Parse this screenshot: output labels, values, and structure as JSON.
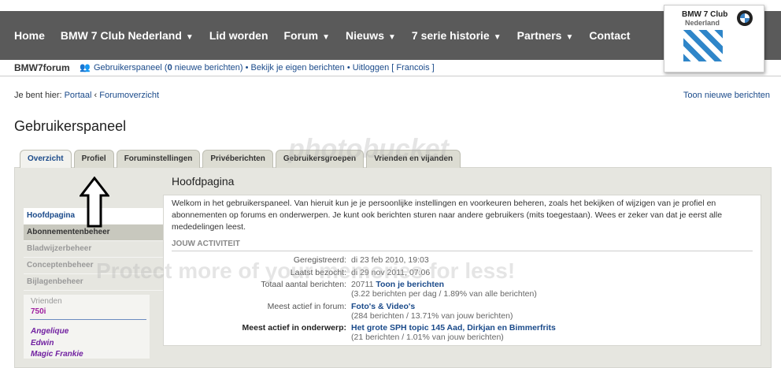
{
  "topnav": {
    "items": [
      {
        "label": "Home",
        "caret": false
      },
      {
        "label": "BMW 7 Club Nederland",
        "caret": true
      },
      {
        "label": "Lid worden",
        "caret": false
      },
      {
        "label": "Forum",
        "caret": true
      },
      {
        "label": "Nieuws",
        "caret": true
      },
      {
        "label": "7 serie historie",
        "caret": true
      },
      {
        "label": "Partners",
        "caret": true
      },
      {
        "label": "Contact",
        "caret": false
      }
    ]
  },
  "logo": {
    "line1": "BMW 7 Club",
    "line2": "Nederland"
  },
  "subbar": {
    "brand": "BMW7forum",
    "control_panel": "Gebruikerspaneel (",
    "new_count": "0",
    "new_messages": " nieuwe berichten)",
    "sep1": " • ",
    "own_posts": "Bekijk je eigen berichten",
    "sep2": " • ",
    "logout": "Uitloggen [ Francois ]"
  },
  "breadcrumb": {
    "prefix": "Je bent hier: ",
    "portal": "Portaal",
    "sep": " ‹ ",
    "forum": "Forumoverzicht"
  },
  "new_posts_link": "Toon nieuwe berichten",
  "page_title": "Gebruikerspaneel",
  "tabs": [
    "Overzicht",
    "Profiel",
    "Foruminstellingen",
    "Privéberichten",
    "Gebruikersgroepen",
    "Vrienden en vijanden"
  ],
  "sidebar": {
    "items": [
      "Hoofdpagina",
      "Abonnementenbeheer",
      "Bladwijzerbeheer",
      "Conceptenbeheer",
      "Bijlagenbeheer"
    ],
    "friends_title": "Vrienden",
    "friends_first": "750i",
    "friends": [
      "Angelique",
      "Edwin",
      "Magic Frankie"
    ]
  },
  "main": {
    "heading": "Hoofdpagina",
    "intro": "Welkom in het gebruikerspaneel. Van hieruit kun je je persoonlijke instellingen en voorkeuren beheren, zoals het bekijken of wijzigen van je profiel en abonnementen op forums en onderwerpen. Je kunt ook berichten sturen naar andere gebruikers (mits toegestaan). Wees er zeker van dat je eerst alle mededelingen leest.",
    "activity_title": "JOUW ACTIVITEIT",
    "registered_label": "Geregistreerd:",
    "registered_value": "di 23 feb 2010, 19:03",
    "last_visit_label": "Laatst bezocht:",
    "last_visit_value": "di 29 nov 2011, 07:06",
    "total_posts_label": "Totaal aantal berichten:",
    "total_posts_value": "20711",
    "show_posts": "Toon je berichten",
    "posts_stats": "(3.22 berichten per dag / 1.89% van alle berichten)",
    "active_forum_label": "Meest actief in forum:",
    "active_forum_value": "Foto's & Video's",
    "active_forum_stats": "(284 berichten / 13.71% van jouw berichten)",
    "active_topic_label": "Meest actief in onderwerp:",
    "active_topic_value": "Het grote SPH topic 145 Aad, Dirkjan en Bimmerfrits",
    "active_topic_stats": "(21 berichten / 1.01% van jouw berichten)"
  },
  "watermark": {
    "brand": "photobucket",
    "tagline": "Protect more of your memories for less!"
  }
}
